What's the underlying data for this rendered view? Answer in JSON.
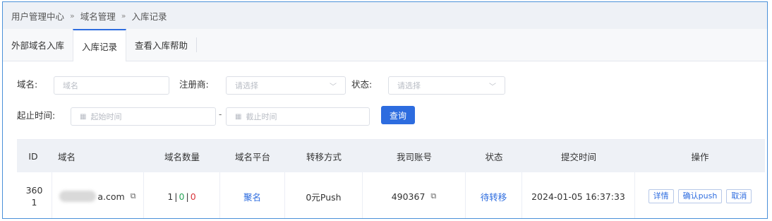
{
  "breadcrumb": {
    "items": [
      "用户管理中心",
      "域名管理",
      "入库记录"
    ],
    "sep": "»"
  },
  "tabs": [
    {
      "label": "外部域名入库",
      "active": false
    },
    {
      "label": "入库记录",
      "active": true
    },
    {
      "label": "查看入库帮助",
      "active": false
    }
  ],
  "filters": {
    "domain_label": "域名:",
    "domain_placeholder": "域名",
    "registrar_label": "注册商:",
    "registrar_placeholder": "请选择",
    "status_label": "状态:",
    "status_placeholder": "请选择",
    "date_label": "起止时间:",
    "start_placeholder": "起始时间",
    "end_placeholder": "截止时间",
    "date_sep": "-",
    "query_button": "查询"
  },
  "table": {
    "columns": [
      "ID",
      "域名",
      "域名数量",
      "域名平台",
      "转移方式",
      "我司账号",
      "状态",
      "提交时间",
      "操作"
    ],
    "rows": [
      {
        "id_line1": "360",
        "id_line2": "1",
        "domain_suffix": "a.com",
        "count_total": "1",
        "count_sep1": "|",
        "count_success": "0",
        "count_sep2": "|",
        "count_fail": "0",
        "platform": "聚名",
        "transfer": "0元Push",
        "account": "490367",
        "status": "待转移",
        "submitted": "2024-01-05 16:37:33",
        "actions": [
          "详情",
          "确认push",
          "取消"
        ]
      }
    ]
  },
  "colors": {
    "accent": "#2d6cdf",
    "success": "#2aa55a",
    "danger": "#d9353b",
    "frame": "#4a90d9"
  }
}
